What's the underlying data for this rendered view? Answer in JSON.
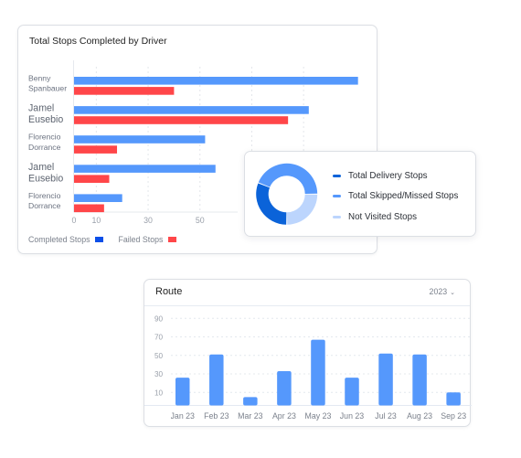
{
  "colors": {
    "completed_bar": "#5598fc",
    "completed_legend": "#0b4fe8",
    "failed_bar": "#ff4649",
    "delivery": "#0b63d9",
    "skipped": "#5598fc",
    "not_visited": "#bcd5fd",
    "route_bar": "#5598fc"
  },
  "driver_card": {
    "title": "Total Stops Completed by Driver",
    "legend": [
      {
        "label": "Completed Stops",
        "color_key": "completed_legend"
      },
      {
        "label": "Failed Stops",
        "color_key": "failed_bar"
      }
    ]
  },
  "donut_card": {
    "legend": [
      {
        "label": "Total Delivery Stops",
        "color_key": "delivery"
      },
      {
        "label": "Total Skipped/Missed Stops",
        "color_key": "skipped"
      },
      {
        "label": "Not Visited Stops",
        "color_key": "not_visited"
      }
    ]
  },
  "route_card": {
    "title": "Route",
    "year_select": "2023",
    "chevron_icon": "chevron-down-icon"
  },
  "chart_data": [
    {
      "type": "bar",
      "orientation": "horizontal",
      "title": "Total Stops Completed by Driver",
      "categories": [
        [
          "Benny",
          "Spanbauer"
        ],
        [
          "Jamel",
          "Eusebio"
        ],
        [
          "Florencio",
          "Dorrance"
        ],
        [
          "Jamel",
          "Eusebio"
        ],
        [
          "Florencio",
          "Dorrance"
        ]
      ],
      "label_emphasis": [
        false,
        true,
        false,
        true,
        false
      ],
      "series": [
        {
          "name": "Completed Stops",
          "values": [
            111,
            92,
            52,
            56,
            20
          ]
        },
        {
          "name": "Failed Stops",
          "values": [
            40,
            84,
            18,
            15,
            13
          ]
        }
      ],
      "x_ticks": [
        0,
        10,
        30,
        50
      ],
      "gridlines": [
        10,
        30,
        50,
        70,
        90
      ],
      "xlim": [
        0,
        115
      ],
      "grid": true,
      "legend": "bottom-left"
    },
    {
      "type": "pie",
      "variant": "donut",
      "labels": [
        "Total Delivery Stops",
        "Total Skipped/Missed Stops",
        "Not Visited Stops"
      ],
      "values": [
        31,
        44,
        25
      ],
      "legend": "right"
    },
    {
      "type": "bar",
      "title": "Route",
      "categories": [
        "Jan 23",
        "Feb 23",
        "Mar 23",
        "Apr 23",
        "May 23",
        "Jun 23",
        "Jul 23",
        "Aug 23",
        "Sep 23"
      ],
      "values": [
        26,
        51,
        5,
        33,
        67,
        26,
        52,
        51,
        10
      ],
      "y_ticks": [
        10,
        30,
        50,
        70,
        90
      ],
      "ylim": [
        0,
        95
      ],
      "grid": true
    }
  ]
}
